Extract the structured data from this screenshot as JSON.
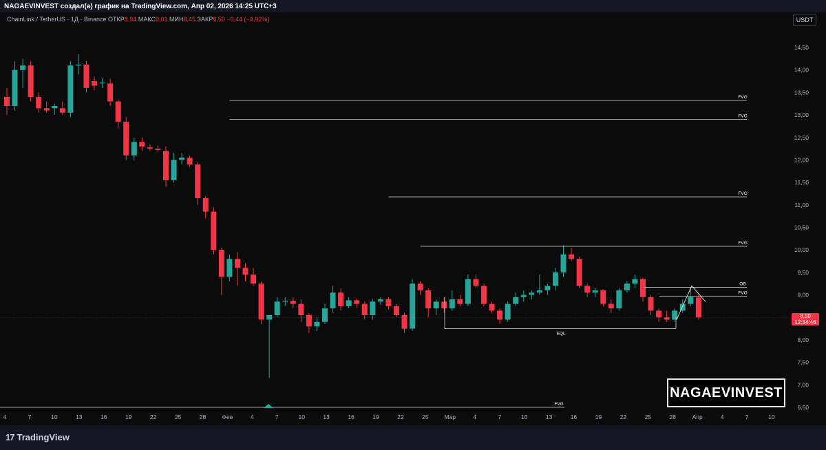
{
  "header": {
    "attribution": "NAGAEVINVEST создал(а) график на TradingView.com, Апр 02, 2026 14:25 UTC+3"
  },
  "symbol": {
    "name": "ChainLink / TetherUS · 1Д · Binance",
    "open_label": "ОТКР",
    "open": "8,94",
    "high_label": "МАКС",
    "high": "9,01",
    "low_label": "МИН",
    "low": "8,45",
    "close_label": "ЗАКР",
    "close": "8,50",
    "change": "−0,44 (−4,92%)"
  },
  "currency_button": "USDT",
  "watermark": "NAGAEVINVEST",
  "footer": {
    "logo_mark": "17",
    "brand": "TradingView"
  },
  "price_tag": {
    "price": "8,50",
    "countdown": "12:34:46"
  },
  "colors": {
    "up": "#26a69a",
    "down": "#f23645",
    "background": "#0b0b0b",
    "level_line": "#d1d4dc"
  },
  "chart_data": {
    "type": "candlestick",
    "y_ticks": [
      "14,50",
      "14,00",
      "13,50",
      "13,00",
      "12,50",
      "12,00",
      "11,50",
      "11,00",
      "10,50",
      "10,00",
      "9,50",
      "9,00",
      "8,50",
      "8,00",
      "7,50",
      "7,00",
      "6,50"
    ],
    "x_ticks": [
      "4",
      "7",
      "10",
      "13",
      "16",
      "19",
      "22",
      "25",
      "28",
      "Фев",
      "4",
      "7",
      "10",
      "13",
      "16",
      "19",
      "22",
      "25",
      "Мар",
      "4",
      "7",
      "10",
      "13",
      "16",
      "19",
      "22",
      "25",
      "28",
      "Апр",
      "4",
      "7",
      "10"
    ],
    "ylim": [
      6.5,
      14.8
    ],
    "last_price": 8.5,
    "candles": [
      {
        "o": 13.4,
        "h": 13.6,
        "l": 13.0,
        "c": 13.2
      },
      {
        "o": 13.2,
        "h": 14.2,
        "l": 13.1,
        "c": 14.0
      },
      {
        "o": 14.0,
        "h": 14.25,
        "l": 13.6,
        "c": 14.1
      },
      {
        "o": 14.1,
        "h": 14.2,
        "l": 13.3,
        "c": 13.4
      },
      {
        "o": 13.4,
        "h": 13.5,
        "l": 13.05,
        "c": 13.15
      },
      {
        "o": 13.15,
        "h": 13.3,
        "l": 13.05,
        "c": 13.1
      },
      {
        "o": 13.15,
        "h": 13.25,
        "l": 13.0,
        "c": 13.2
      },
      {
        "o": 13.15,
        "h": 13.3,
        "l": 13.0,
        "c": 13.05
      },
      {
        "o": 13.05,
        "h": 14.2,
        "l": 12.95,
        "c": 14.1
      },
      {
        "o": 14.1,
        "h": 14.35,
        "l": 13.9,
        "c": 14.12
      },
      {
        "o": 14.12,
        "h": 14.2,
        "l": 13.5,
        "c": 13.6
      },
      {
        "o": 13.75,
        "h": 13.85,
        "l": 13.55,
        "c": 13.65
      },
      {
        "o": 13.72,
        "h": 13.82,
        "l": 13.6,
        "c": 13.72
      },
      {
        "o": 13.7,
        "h": 13.8,
        "l": 13.2,
        "c": 13.3
      },
      {
        "o": 13.3,
        "h": 13.35,
        "l": 12.7,
        "c": 12.85
      },
      {
        "o": 12.85,
        "h": 12.95,
        "l": 12.0,
        "c": 12.1
      },
      {
        "o": 12.1,
        "h": 12.5,
        "l": 12.0,
        "c": 12.4
      },
      {
        "o": 12.4,
        "h": 12.5,
        "l": 12.2,
        "c": 12.3
      },
      {
        "o": 12.28,
        "h": 12.35,
        "l": 12.2,
        "c": 12.25
      },
      {
        "o": 12.25,
        "h": 12.32,
        "l": 12.18,
        "c": 12.22
      },
      {
        "o": 12.2,
        "h": 12.3,
        "l": 11.4,
        "c": 11.55
      },
      {
        "o": 11.55,
        "h": 12.15,
        "l": 11.5,
        "c": 12.0
      },
      {
        "o": 12.0,
        "h": 12.15,
        "l": 11.9,
        "c": 12.05
      },
      {
        "o": 12.05,
        "h": 12.1,
        "l": 11.85,
        "c": 11.9
      },
      {
        "o": 11.9,
        "h": 11.95,
        "l": 11.0,
        "c": 11.15
      },
      {
        "o": 11.15,
        "h": 11.2,
        "l": 10.7,
        "c": 10.85
      },
      {
        "o": 10.85,
        "h": 10.95,
        "l": 9.9,
        "c": 10.0
      },
      {
        "o": 10.0,
        "h": 10.05,
        "l": 9.0,
        "c": 9.4
      },
      {
        "o": 9.4,
        "h": 9.9,
        "l": 9.3,
        "c": 9.8
      },
      {
        "o": 9.8,
        "h": 9.95,
        "l": 9.2,
        "c": 9.6
      },
      {
        "o": 9.6,
        "h": 9.7,
        "l": 9.3,
        "c": 9.45
      },
      {
        "o": 9.45,
        "h": 9.6,
        "l": 9.2,
        "c": 9.25
      },
      {
        "o": 9.25,
        "h": 9.3,
        "l": 8.35,
        "c": 8.45
      },
      {
        "o": 8.45,
        "h": 8.5,
        "l": 7.15,
        "c": 8.55
      },
      {
        "o": 8.55,
        "h": 8.95,
        "l": 8.5,
        "c": 8.85
      },
      {
        "o": 8.85,
        "h": 8.95,
        "l": 8.75,
        "c": 8.87
      },
      {
        "o": 8.87,
        "h": 8.95,
        "l": 8.7,
        "c": 8.8
      },
      {
        "o": 8.8,
        "h": 8.9,
        "l": 8.4,
        "c": 8.55
      },
      {
        "o": 8.55,
        "h": 8.6,
        "l": 8.15,
        "c": 8.3
      },
      {
        "o": 8.3,
        "h": 8.5,
        "l": 8.2,
        "c": 8.4
      },
      {
        "o": 8.4,
        "h": 8.8,
        "l": 8.35,
        "c": 8.7
      },
      {
        "o": 8.7,
        "h": 9.2,
        "l": 8.6,
        "c": 9.05
      },
      {
        "o": 9.05,
        "h": 9.15,
        "l": 8.65,
        "c": 8.75
      },
      {
        "o": 8.75,
        "h": 8.95,
        "l": 8.7,
        "c": 8.88
      },
      {
        "o": 8.88,
        "h": 8.92,
        "l": 8.72,
        "c": 8.8
      },
      {
        "o": 8.8,
        "h": 8.85,
        "l": 8.45,
        "c": 8.55
      },
      {
        "o": 8.55,
        "h": 8.9,
        "l": 8.45,
        "c": 8.85
      },
      {
        "o": 8.85,
        "h": 8.95,
        "l": 8.78,
        "c": 8.9
      },
      {
        "o": 8.9,
        "h": 8.95,
        "l": 8.68,
        "c": 8.75
      },
      {
        "o": 8.75,
        "h": 8.8,
        "l": 8.5,
        "c": 8.55
      },
      {
        "o": 8.55,
        "h": 8.6,
        "l": 8.15,
        "c": 8.25
      },
      {
        "o": 8.25,
        "h": 9.35,
        "l": 8.2,
        "c": 9.25
      },
      {
        "o": 9.25,
        "h": 9.3,
        "l": 9.0,
        "c": 9.1
      },
      {
        "o": 9.1,
        "h": 9.15,
        "l": 8.5,
        "c": 8.7
      },
      {
        "o": 8.7,
        "h": 8.9,
        "l": 8.55,
        "c": 8.85
      },
      {
        "o": 8.85,
        "h": 8.95,
        "l": 8.6,
        "c": 8.7
      },
      {
        "o": 8.7,
        "h": 9.1,
        "l": 8.65,
        "c": 8.9
      },
      {
        "o": 8.9,
        "h": 9.0,
        "l": 8.75,
        "c": 8.8
      },
      {
        "o": 8.8,
        "h": 9.45,
        "l": 8.75,
        "c": 9.35
      },
      {
        "o": 9.35,
        "h": 9.45,
        "l": 9.15,
        "c": 9.2
      },
      {
        "o": 9.2,
        "h": 9.25,
        "l": 8.75,
        "c": 8.8
      },
      {
        "o": 8.8,
        "h": 8.85,
        "l": 8.6,
        "c": 8.65
      },
      {
        "o": 8.65,
        "h": 8.7,
        "l": 8.35,
        "c": 8.45
      },
      {
        "o": 8.45,
        "h": 8.85,
        "l": 8.4,
        "c": 8.8
      },
      {
        "o": 8.8,
        "h": 9.05,
        "l": 8.75,
        "c": 8.95
      },
      {
        "o": 8.95,
        "h": 9.1,
        "l": 8.85,
        "c": 9.0
      },
      {
        "o": 9.0,
        "h": 9.1,
        "l": 8.9,
        "c": 9.05
      },
      {
        "o": 9.05,
        "h": 9.45,
        "l": 9.0,
        "c": 9.1
      },
      {
        "o": 9.1,
        "h": 9.25,
        "l": 9.0,
        "c": 9.2
      },
      {
        "o": 9.2,
        "h": 9.6,
        "l": 9.1,
        "c": 9.5
      },
      {
        "o": 9.5,
        "h": 10.1,
        "l": 9.4,
        "c": 9.9
      },
      {
        "o": 9.9,
        "h": 10.05,
        "l": 9.75,
        "c": 9.8
      },
      {
        "o": 9.8,
        "h": 9.85,
        "l": 9.15,
        "c": 9.2
      },
      {
        "o": 9.2,
        "h": 9.25,
        "l": 8.95,
        "c": 9.05
      },
      {
        "o": 9.05,
        "h": 9.15,
        "l": 8.95,
        "c": 9.1
      },
      {
        "o": 9.1,
        "h": 9.12,
        "l": 8.75,
        "c": 8.8
      },
      {
        "o": 8.8,
        "h": 8.9,
        "l": 8.6,
        "c": 8.7
      },
      {
        "o": 8.7,
        "h": 9.15,
        "l": 8.65,
        "c": 9.1
      },
      {
        "o": 9.1,
        "h": 9.3,
        "l": 9.05,
        "c": 9.25
      },
      {
        "o": 9.25,
        "h": 9.45,
        "l": 9.15,
        "c": 9.35
      },
      {
        "o": 9.35,
        "h": 9.38,
        "l": 8.85,
        "c": 8.95
      },
      {
        "o": 8.95,
        "h": 9.0,
        "l": 8.55,
        "c": 8.65
      },
      {
        "o": 8.65,
        "h": 8.7,
        "l": 8.4,
        "c": 8.5
      },
      {
        "o": 8.5,
        "h": 8.65,
        "l": 8.4,
        "c": 8.45
      },
      {
        "o": 8.45,
        "h": 8.7,
        "l": 8.4,
        "c": 8.65
      },
      {
        "o": 8.65,
        "h": 8.9,
        "l": 8.6,
        "c": 8.8
      },
      {
        "o": 8.8,
        "h": 9.15,
        "l": 8.75,
        "c": 8.95
      },
      {
        "o": 8.94,
        "h": 9.01,
        "l": 8.45,
        "c": 8.5
      }
    ],
    "levels": [
      {
        "label": "FVG",
        "price": 13.32,
        "from": 28
      },
      {
        "label": "FVG",
        "price": 12.9,
        "from": 28
      },
      {
        "label": "FVG",
        "price": 11.18,
        "from": 48
      },
      {
        "label": "FVG",
        "price": 10.08,
        "from": 52
      },
      {
        "label": "OB",
        "price": 9.17,
        "from": 148
      },
      {
        "label": "FVG",
        "price": 8.97,
        "from": 153
      },
      {
        "label": "FVG",
        "price": 6.5,
        "from": 0
      },
      {
        "label": "EQL",
        "price": 8.25,
        "from": 99
      }
    ]
  }
}
